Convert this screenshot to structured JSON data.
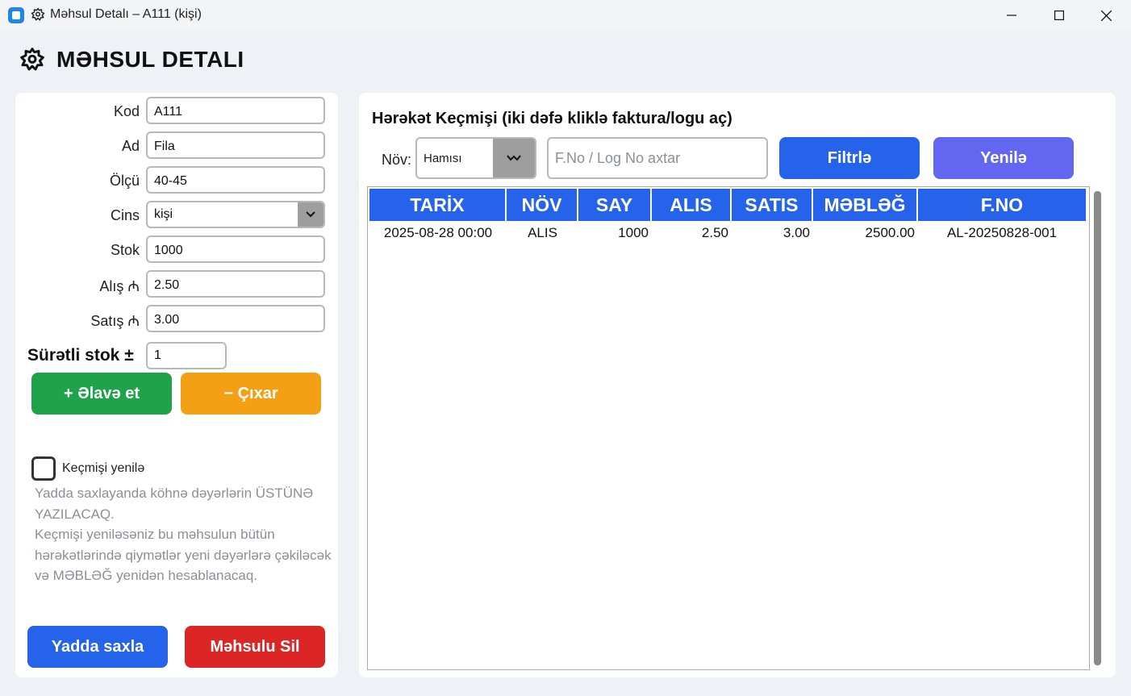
{
  "window": {
    "title": "Məhsul Detalı – A111 (kişi)"
  },
  "page": {
    "title": "MƏHSUL DETALI"
  },
  "form": {
    "fields": [
      {
        "label": "Kod",
        "value": "A111"
      },
      {
        "label": "Ad",
        "value": "Fila"
      },
      {
        "label": "Ölçü",
        "value": "40-45"
      },
      {
        "label": "Cins",
        "value": "kişi"
      },
      {
        "label": "Stok",
        "value": "1000"
      },
      {
        "label": "Alış ₼",
        "value": "2.50"
      },
      {
        "label": "Satış ₼",
        "value": "3.00"
      }
    ],
    "quick_stock_label": "Sürətli stok ±",
    "quick_stock_value": "1",
    "add_label": "+ Əlavə et",
    "remove_label": "− Çıxar",
    "history_refresh_label": "Keçmişi yenilə",
    "history_refresh_checked": false,
    "warning_text": "Yadda saxlayanda köhnə dəyərlərin ÜSTÜNƏ YAZILACAQ.\nKeçmişi yeniləsəniz bu məhsulun bütün hərəkətlərində qiymətlər yeni dəyərlərə çəkiləcək və MƏBLƏĞ yenidən hesablanacaq.",
    "save_label": "Yadda saxla",
    "delete_label": "Məhsulu Sil"
  },
  "history": {
    "title": "Hərəkət Keçmişi (iki dəfə kliklə faktura/logu aç)",
    "type_label": "Növ:",
    "type_value": "Hamısı",
    "search_placeholder": "F.No / Log No axtar",
    "filter_label": "Filtrlə",
    "refresh_label": "Yenilə",
    "columns": [
      "TARİX",
      "NÖV",
      "SAY",
      "ALIS",
      "SATIS",
      "MƏBLƏĞ",
      "F.NO"
    ],
    "rows": [
      [
        "2025-08-28 00:00",
        "ALIS",
        "1000",
        "2.50",
        "3.00",
        "2500.00",
        "AL-20250828-001"
      ]
    ]
  },
  "colors": {
    "primary": "#2563eb",
    "success": "#1fa34a",
    "warning": "#f4a015",
    "danger": "#dc2626",
    "indigo": "#6366f1"
  }
}
